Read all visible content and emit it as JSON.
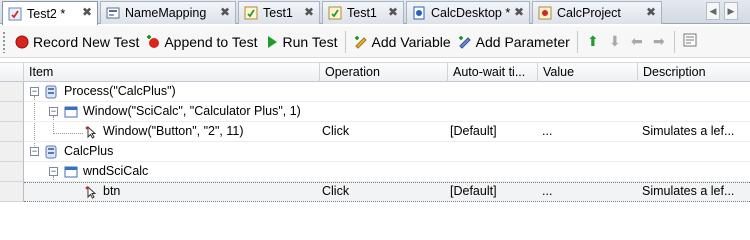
{
  "tabs": [
    {
      "label": "Test2 *",
      "close": "✖",
      "active": true,
      "icon": "test-icon"
    },
    {
      "label": "NameMapping",
      "close": "✖",
      "icon": "namemapping-icon"
    },
    {
      "label": "Test1",
      "close": "✖",
      "icon": "test-icon"
    },
    {
      "label": "Test1",
      "close": "✖",
      "icon": "test-icon"
    },
    {
      "label": "CalcDesktop *",
      "close": "✖",
      "icon": "project-icon"
    },
    {
      "label": "CalcProject",
      "close": "✖",
      "icon": "project-icon"
    }
  ],
  "tab_nav": {
    "left": "◀",
    "right": "▶"
  },
  "toolbar": {
    "record_label": "Record New Test",
    "append_label": "Append to Test",
    "run_label": "Run Test",
    "add_variable_label": "Add Variable",
    "add_parameter_label": "Add Parameter",
    "up_glyph": "⬆",
    "down_glyph": "⬇",
    "left_glyph": "⬅",
    "right_glyph": "➡"
  },
  "grid": {
    "columns": [
      "Item",
      "Operation",
      "Auto-wait ti...",
      "Value",
      "Description"
    ],
    "rows": [
      {
        "item": "Process(\"CalcPlus\")",
        "operation": "",
        "autowait": "",
        "value": "",
        "description": "",
        "level": 0,
        "icon": "process-icon",
        "expanded": true
      },
      {
        "item": "Window(\"SciCalc\", \"Calculator Plus\", 1)",
        "operation": "",
        "autowait": "",
        "value": "",
        "description": "",
        "level": 1,
        "icon": "window-icon",
        "expanded": true
      },
      {
        "item": "Window(\"Button\", \"2\", 11)",
        "operation": "Click",
        "autowait": "[Default]",
        "value": "...",
        "description": "Simulates a lef...",
        "level": 2,
        "icon": "click-icon"
      },
      {
        "item": "CalcPlus",
        "operation": "",
        "autowait": "",
        "value": "",
        "description": "",
        "level": 0,
        "icon": "process-icon",
        "expanded": true
      },
      {
        "item": "wndSciCalc",
        "operation": "",
        "autowait": "",
        "value": "",
        "description": "",
        "level": 1,
        "icon": "window-icon",
        "expanded": true
      },
      {
        "item": "btn",
        "operation": "Click",
        "autowait": "[Default]",
        "value": "...",
        "description": "Simulates a lef...",
        "level": 2,
        "icon": "click-icon",
        "selected": true
      }
    ],
    "expander_glyph": "−"
  },
  "colors": {
    "accent_red": "#d9261c",
    "run_green": "#1f9d2a",
    "folder_yellow": "#e8b531",
    "window_blue": "#3b6fc4"
  }
}
